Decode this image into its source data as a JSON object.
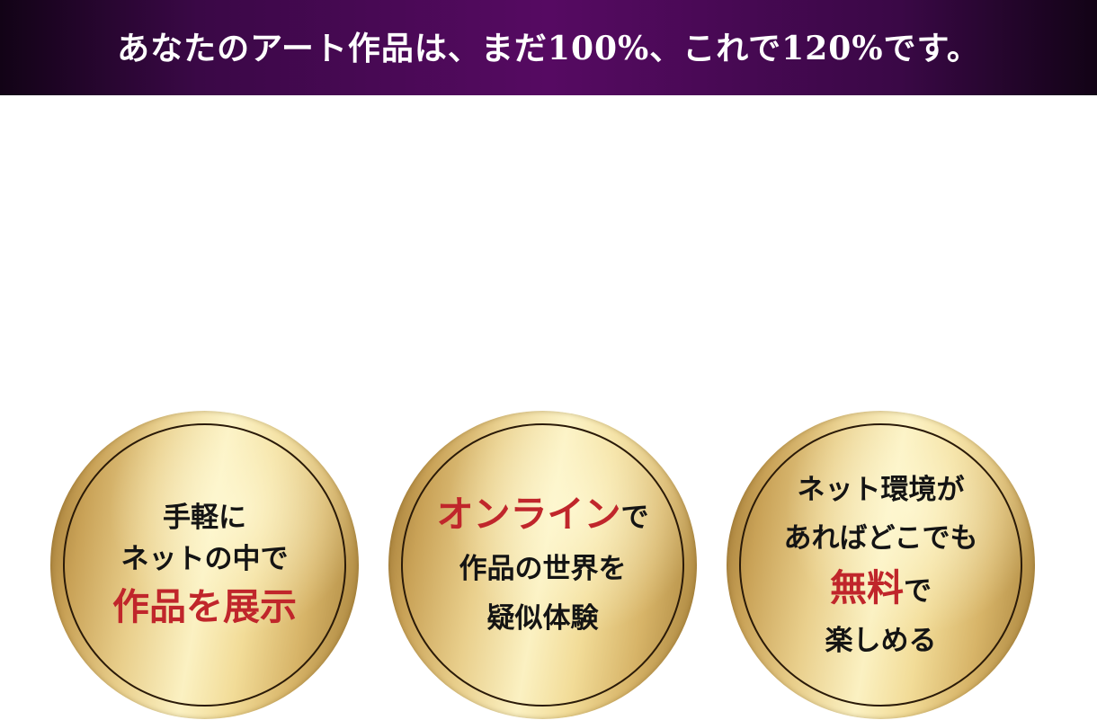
{
  "header": {
    "title": "あなたのアート作品は、まだ100%、これで120%です。"
  },
  "badges": [
    {
      "line1": "手軽に",
      "line2": "ネットの中で",
      "line3_highlight": "作品を展示"
    },
    {
      "line1_highlight": "オンライン",
      "line1_tail": "で",
      "line2": "作品の世界を",
      "line3": "疑似体験"
    },
    {
      "line1": "ネット環境が",
      "line2": "あればどこでも",
      "line3_highlight": "無料",
      "line3_tail": "で",
      "line4": "楽しめる"
    }
  ],
  "colors": {
    "banner_purple": "#560a62",
    "banner_dark": "#120316",
    "highlight_red": "#c0262b",
    "gold_light": "#fbf1c2",
    "gold_dark": "#9a7330"
  }
}
